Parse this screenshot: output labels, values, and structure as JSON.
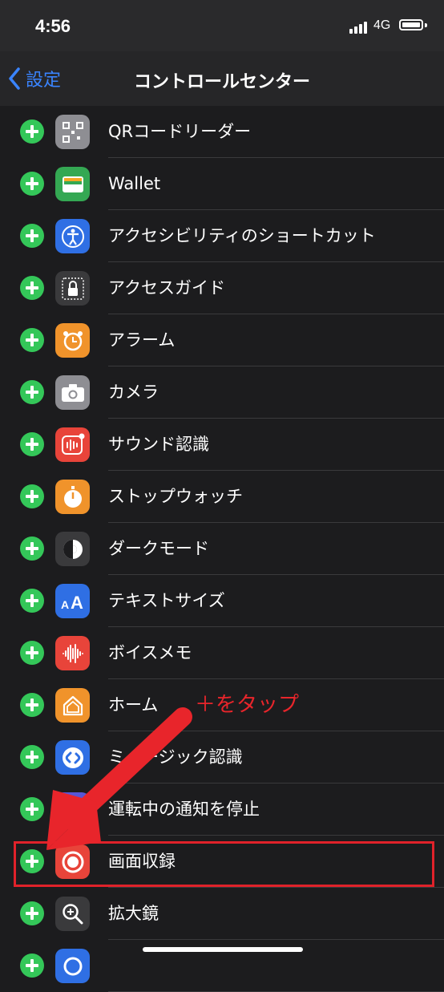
{
  "status_bar": {
    "time": "4:56",
    "network": "4G"
  },
  "nav": {
    "back_label": "設定",
    "title": "コントロールセンター"
  },
  "items": [
    {
      "label": "QRコードリーダー",
      "icon": "qr-code-icon",
      "color": "#8e8e93"
    },
    {
      "label": "Wallet",
      "icon": "wallet-icon",
      "color": "#34a853"
    },
    {
      "label": "アクセシビリティのショートカット",
      "icon": "accessibility-icon",
      "color": "#2f6fe4"
    },
    {
      "label": "アクセスガイド",
      "icon": "lock-icon",
      "color": "#3a3a3c"
    },
    {
      "label": "アラーム",
      "icon": "alarm-clock-icon",
      "color": "#f0932b"
    },
    {
      "label": "カメラ",
      "icon": "camera-icon",
      "color": "#8e8e93"
    },
    {
      "label": "サウンド認識",
      "icon": "sound-recognition-icon",
      "color": "#e8443a"
    },
    {
      "label": "ストップウォッチ",
      "icon": "stopwatch-icon",
      "color": "#f0932b"
    },
    {
      "label": "ダークモード",
      "icon": "dark-mode-icon",
      "color": "#3a3a3c"
    },
    {
      "label": "テキストサイズ",
      "icon": "text-size-icon",
      "color": "#2f6fe4"
    },
    {
      "label": "ボイスメモ",
      "icon": "voice-memo-icon",
      "color": "#e8443a"
    },
    {
      "label": "ホーム",
      "icon": "home-icon",
      "color": "#f0932b"
    },
    {
      "label": "ミュージック認識",
      "icon": "shazam-icon",
      "color": "#2f6fe4"
    },
    {
      "label": "運転中の通知を停止",
      "icon": "car-icon",
      "color": "#5856d6"
    },
    {
      "label": "画面収録",
      "icon": "screen-record-icon",
      "color": "#e8443a"
    },
    {
      "label": "拡大鏡",
      "icon": "magnifier-icon",
      "color": "#3a3a3c"
    },
    {
      "label": "",
      "icon": "partial-icon",
      "color": "#2f6fe4"
    }
  ],
  "annotation": {
    "text": "＋をタップ",
    "color": "#e8252b"
  },
  "colors": {
    "background": "#1c1c1e",
    "add_button": "#34c759",
    "accent": "#3a84ff"
  }
}
